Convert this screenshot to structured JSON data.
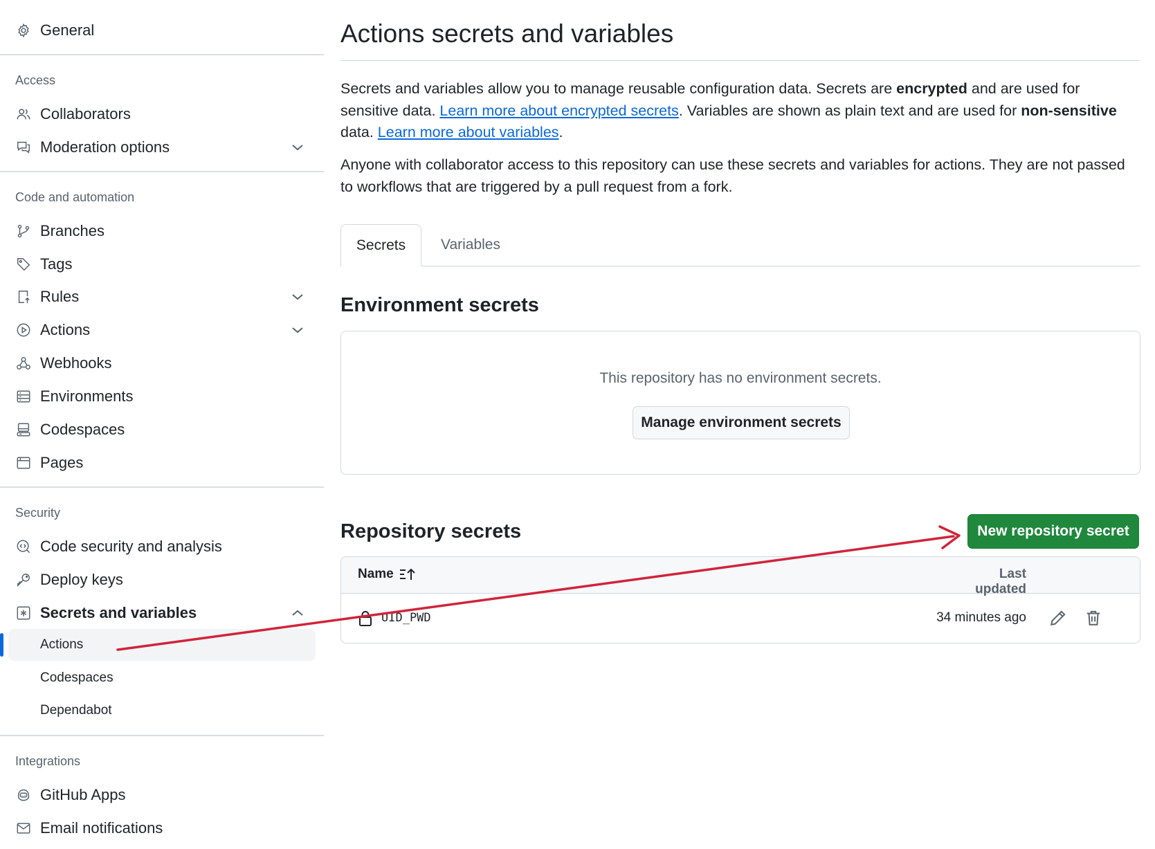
{
  "sidebar": {
    "general": {
      "label": "General",
      "icon": "gear-icon"
    },
    "sections": {
      "access": "Access",
      "code_automation": "Code and automation",
      "security": "Security",
      "integrations": "Integrations"
    },
    "items": {
      "collaborators": "Collaborators",
      "moderation": "Moderation options",
      "branches": "Branches",
      "tags": "Tags",
      "rules": "Rules",
      "actions": "Actions",
      "webhooks": "Webhooks",
      "environments": "Environments",
      "codespaces": "Codespaces",
      "pages": "Pages",
      "code_security": "Code security and analysis",
      "deploy_keys": "Deploy keys",
      "secrets_variables": "Secrets and variables",
      "github_apps": "GitHub Apps",
      "email_notifications": "Email notifications"
    },
    "sub_items": {
      "actions": "Actions",
      "codespaces": "Codespaces",
      "dependabot": "Dependabot"
    },
    "active_sub_item": "Actions"
  },
  "main": {
    "title": "Actions secrets and variables",
    "intro": {
      "t1": "Secrets and variables allow you to manage reusable configuration data. Secrets are ",
      "b1": "encrypted",
      "t2": " and are used for sensitive data. ",
      "link1": "Learn more about encrypted secrets",
      "t3": ". Variables are shown as plain text and are used for ",
      "b2": "non-sensitive",
      "t4": " data. ",
      "link2": "Learn more about variables",
      "t5": "."
    },
    "notice": "Anyone with collaborator access to this repository can use these secrets and variables for actions. They are not passed to workflows that are triggered by a pull request from a fork.",
    "tabs": {
      "secrets": "Secrets",
      "variables": "Variables",
      "selected": "Secrets"
    },
    "environment": {
      "heading": "Environment secrets",
      "empty_text": "This repository has no environment secrets.",
      "manage_button": "Manage environment secrets"
    },
    "repository": {
      "heading": "Repository secrets",
      "new_button": "New repository secret",
      "columns": {
        "name": "Name",
        "last_updated": "Last updated"
      },
      "rows": [
        {
          "name": "UID_PWD",
          "updated": "34 minutes ago"
        }
      ]
    }
  },
  "colors": {
    "accent_blue": "#0969da",
    "primary_green": "#1f883d",
    "annotation_red": "#d0243a"
  }
}
